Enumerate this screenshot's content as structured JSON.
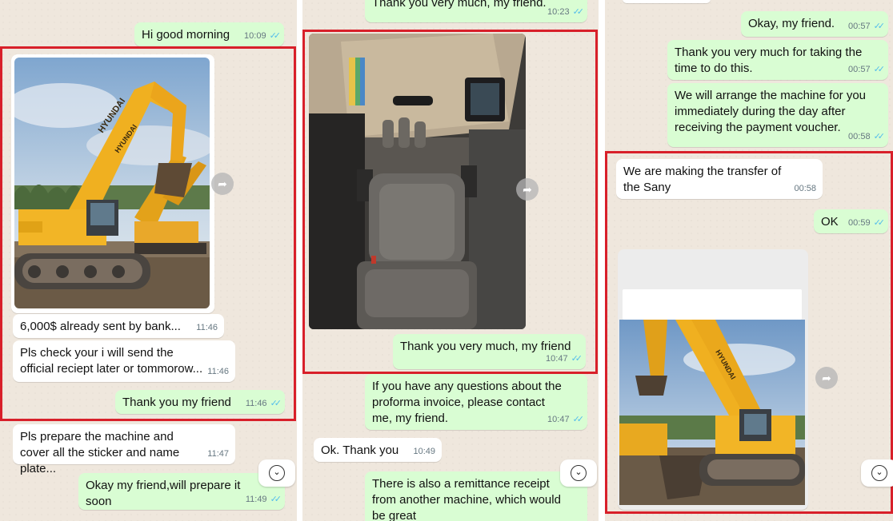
{
  "colors": {
    "outgoing": "#d9fdd3",
    "incoming": "#ffffff",
    "highlight": "#d8202a",
    "read_ticks": "#53bdeb"
  },
  "icons": {
    "read_receipt": "double-check-icon",
    "forward": "forward-arrow-icon",
    "scroll_down": "chevron-down-icon"
  },
  "panel1": {
    "messages": [
      {
        "text": "Hi good morning",
        "time": "10:09"
      },
      {
        "text": "6,000$ already sent by bank...",
        "time": "11:46"
      },
      {
        "text": "Pls check your i will send the official reciept later or tommorow...",
        "time": "11:46"
      },
      {
        "text": "Thank you my friend",
        "time": "11:46"
      },
      {
        "text": "Pls prepare the machine and cover all the sticker and name plate...",
        "time": "11:47"
      },
      {
        "text": "Okay my friend,will prepare it soon",
        "time": "11:49"
      }
    ],
    "image_brand_text": "HYUNDAI"
  },
  "panel2": {
    "messages": [
      {
        "text": "Thank you very much, my friend.",
        "time": "10:23"
      },
      {
        "text": "Thank you very much, my friend",
        "time": "10:47"
      },
      {
        "text": "If you have any questions about the proforma invoice, please contact me, my friend.",
        "time": "10:47"
      },
      {
        "text": "Ok. Thank you",
        "time": "10:49"
      },
      {
        "text": "There is also a remittance receipt from another machine, which would be great",
        "time": ""
      }
    ]
  },
  "panel3": {
    "messages": [
      {
        "text": "Okay, my friend.",
        "time": "00:57"
      },
      {
        "text": "Thank you very much for taking the time to do this.",
        "time": "00:57"
      },
      {
        "text": "We will arrange the machine for you immediately during the day after receiving the payment voucher.",
        "time": "00:58"
      },
      {
        "text": "We are making the transfer of the Sany",
        "time": "00:58"
      },
      {
        "text": "OK",
        "time": "00:59"
      }
    ],
    "image_brand_text": "HYUNDAI"
  }
}
